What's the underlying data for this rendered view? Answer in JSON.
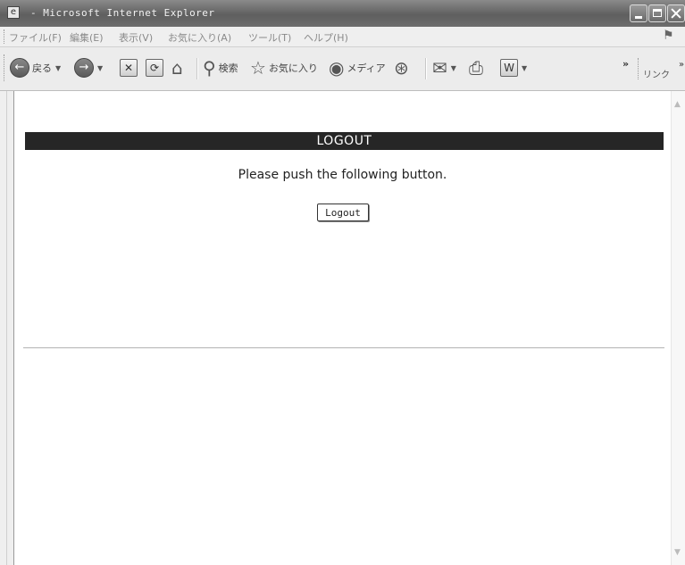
{
  "window": {
    "title": "- Microsoft Internet Explorer"
  },
  "menu": {
    "items": [
      "ファイル(F)",
      "編集(E)",
      "表示(V)",
      "お気に入り(A)",
      "ツール(T)",
      "ヘルプ(H)"
    ]
  },
  "toolbar": {
    "back_label": "戻る",
    "search_label": "検索",
    "favorites_label": "お気に入り",
    "media_label": "メディア",
    "links_label": "リンク",
    "icons": [
      "back-icon",
      "forward-icon",
      "stop-icon",
      "refresh-icon",
      "home-icon",
      "search-icon",
      "favorites-star-icon",
      "media-icon",
      "history-icon",
      "mail-icon",
      "print-icon",
      "edit-word-icon"
    ]
  },
  "page": {
    "banner_title": "LOGOUT",
    "instruction": "Please push the following button.",
    "logout_button": "Logout"
  },
  "colors": {
    "banner_bg": "#262626",
    "banner_text": "#ffffff"
  }
}
